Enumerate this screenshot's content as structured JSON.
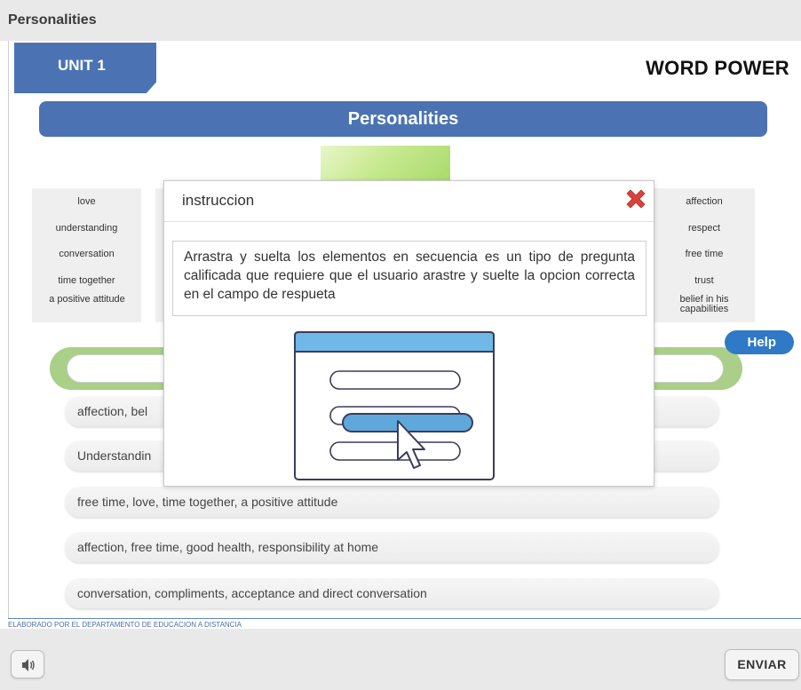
{
  "app": {
    "title": "Personalities"
  },
  "header": {
    "unit_label": "UNIT 1",
    "section_title": "WORD POWER"
  },
  "banner": {
    "title": "Personalities"
  },
  "words_left": [
    "love",
    "understanding",
    "conversation",
    "time together",
    "a positive attitude"
  ],
  "words_right": [
    "affection",
    "respect",
    "free time",
    "trust",
    "belief in his capabilities"
  ],
  "options": [
    "affection, bel",
    "Understandin",
    "free time, love, time together, a positive attitude",
    "affection, free time, good health, responsibility at home",
    "conversation, compliments, acceptance and direct conversation"
  ],
  "help": {
    "label": "Help"
  },
  "modal": {
    "title": "instruccion",
    "text": "Arrastra y suelta los elementos en secuencia es  un tipo de pregunta calificada que requiere que el usuario arastre y suelte la opcion correcta en el campo de respueta"
  },
  "footer": {
    "credit": "ELABORADO POR EL DEPARTAMENTO DE EDUCACION A DISTANCIA"
  },
  "controls": {
    "submit_label": "ENVIAR"
  },
  "icons": {
    "close": "close-x-icon",
    "sound": "speaker-icon",
    "illustration": "drag-drop-illustration"
  },
  "colors": {
    "accent": "#4b73b3",
    "drop_zone": "#a9cf88",
    "help": "#2f79c7",
    "close": "#d9433b"
  }
}
